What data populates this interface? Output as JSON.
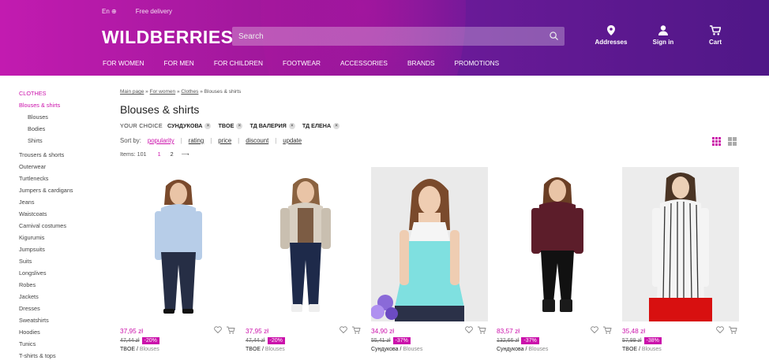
{
  "header": {
    "lang": "En",
    "free_delivery": "Free delivery",
    "logo": "WILDBERRIES",
    "search_placeholder": "Search",
    "icons": [
      {
        "label": "Addresses",
        "icon": "location-pin-icon"
      },
      {
        "label": "Sign in",
        "icon": "user-icon"
      },
      {
        "label": "Cart",
        "icon": "cart-icon"
      }
    ],
    "nav": [
      "FOR WOMEN",
      "FOR MEN",
      "FOR CHILDREN",
      "FOOTWEAR",
      "ACCESSORIES",
      "BRANDS",
      "PROMOTIONS"
    ],
    "colors": {
      "accent": "#cb11ab",
      "gradient_start": "#c21bb0",
      "gradient_end": "#4f1787"
    }
  },
  "sidebar": {
    "items": [
      {
        "label": "CLOTHES",
        "active": true
      },
      {
        "label": "Blouses & shirts",
        "active": true
      },
      {
        "label": "Blouses",
        "sub": true
      },
      {
        "label": "Bodies",
        "sub": true
      },
      {
        "label": "Shirts",
        "sub": true
      },
      {
        "label": "Trousers & shorts"
      },
      {
        "label": "Outerwear"
      },
      {
        "label": "Turtlenecks"
      },
      {
        "label": "Jumpers & cardigans"
      },
      {
        "label": "Jeans"
      },
      {
        "label": "Waistcoats"
      },
      {
        "label": "Carnival costumes"
      },
      {
        "label": "Kigurumis"
      },
      {
        "label": "Jumpsuits"
      },
      {
        "label": "Suits"
      },
      {
        "label": "Longslives"
      },
      {
        "label": "Robes"
      },
      {
        "label": "Jackets"
      },
      {
        "label": "Dresses"
      },
      {
        "label": "Sweatshirts"
      },
      {
        "label": "Hoodies"
      },
      {
        "label": "Tunics"
      },
      {
        "label": "T-shirts & tops"
      }
    ]
  },
  "main": {
    "breadcrumb": [
      "Main page",
      "For women",
      "Clothes",
      "Blouses & shirts"
    ],
    "breadcrumb_sep": "»",
    "title": "Blouses & shirts",
    "your_choice": "YOUR CHOICE",
    "filters": [
      "СУНДУКОВА",
      "TBOE",
      "ТД ВАЛЕРИЯ",
      "ТД ЕЛЕНА"
    ],
    "sort_label": "Sort by:",
    "sort_options": [
      "popularity",
      "rating",
      "price",
      "discount",
      "update"
    ],
    "sort_active": "popularity",
    "items_label": "Items: 101",
    "pages": [
      "1",
      "2"
    ],
    "next_arrow": "⟶"
  },
  "products": [
    {
      "price": "37,95 zł",
      "old_price": "47,44 zł",
      "discount": "-20%",
      "brand": "TBOE",
      "category": "Blouses"
    },
    {
      "price": "37,95 zł",
      "old_price": "47,44 zł",
      "discount": "-20%",
      "brand": "TBOE",
      "category": "Blouses"
    },
    {
      "price": "34,90 zł",
      "old_price": "55,41 zł",
      "discount": "-37%",
      "brand": "Сундукова",
      "category": "Blouses"
    },
    {
      "price": "83,57 zł",
      "old_price": "132,66 zł",
      "discount": "-37%",
      "brand": "Сундукова",
      "category": "Blouses"
    },
    {
      "price": "35,48 zł",
      "old_price": "57,99 zł",
      "discount": "-38%",
      "brand": "TBOE",
      "category": "Blouses"
    }
  ]
}
